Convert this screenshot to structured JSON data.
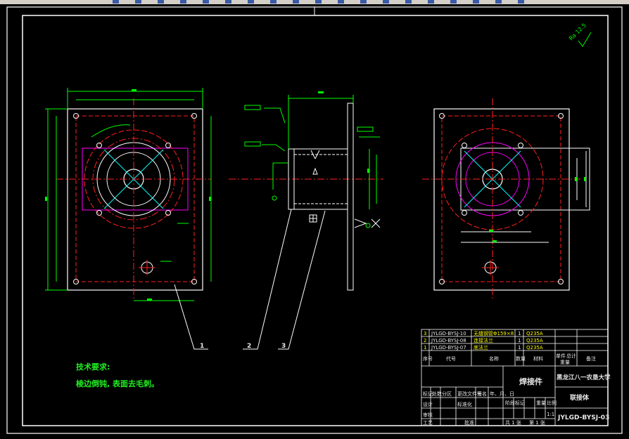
{
  "toolbar": {
    "icons": [
      "new-icon",
      "open-icon",
      "save-icon",
      "print-icon",
      "preview-icon",
      "cut-icon",
      "copy-icon",
      "paste-icon",
      "match-icon",
      "undo-icon",
      "redo-icon",
      "pan-icon",
      "zoom-icon",
      "zoom-window-icon",
      "zoom-previous-icon",
      "properties-icon",
      "design-center-icon",
      "tool-palette-icon",
      "help-icon"
    ]
  },
  "drawing": {
    "roughness_symbol": "Ra 12.5",
    "balloons": [
      "1",
      "2",
      "3"
    ],
    "technical_requirements": {
      "title": "技术要求:",
      "line1": "棱边倒钝, 表面去毛刺。"
    },
    "colors": {
      "frame": "#ffffff",
      "outline": "#ffffff",
      "dimension": "#00ff00",
      "centerline": "#ff2020",
      "hidden": "#ff2020",
      "magenta": "#ff00ff",
      "cyan": "#00ffff",
      "yellow": "#ffff00",
      "text_green": "#22ee22"
    }
  },
  "title_block": {
    "parts": [
      {
        "no": "3",
        "code": "JYLGD-BYSJ-10",
        "name": "无缝钢管Φ159×8",
        "qty": "1",
        "material": "Q235A"
      },
      {
        "no": "2",
        "code": "JYLGD-BYSJ-08",
        "name": "连接法兰",
        "qty": "1",
        "material": "Q235A"
      },
      {
        "no": "1",
        "code": "JYLGD-BYSJ-07",
        "name": "底法兰",
        "qty": "1",
        "material": "Q235A"
      }
    ],
    "header": {
      "no": "序号",
      "code": "代号",
      "name": "名称",
      "qty": "数量",
      "material": "材料",
      "unit_weight": "单件",
      "total_weight": "总计",
      "weight_label": "重量",
      "remarks": "备注"
    },
    "title": "焊接件",
    "school": "黑龙江八一农垦大学",
    "part_name": "联接体",
    "drawing_no": "JYLGD-BYSJ-03",
    "stage": "阶段标记",
    "weight": "重量",
    "scale_label": "比例",
    "scale": "1:1",
    "sheet_total": "共 1 张",
    "sheet_no": "第 1 张",
    "rev_headers": [
      "标记",
      "处数",
      "分区",
      "更改文件号",
      "签名",
      "年、月、日"
    ],
    "roles": [
      "设计",
      "审核",
      "工艺"
    ],
    "std_label": "标准化",
    "approve_label": "批准"
  }
}
